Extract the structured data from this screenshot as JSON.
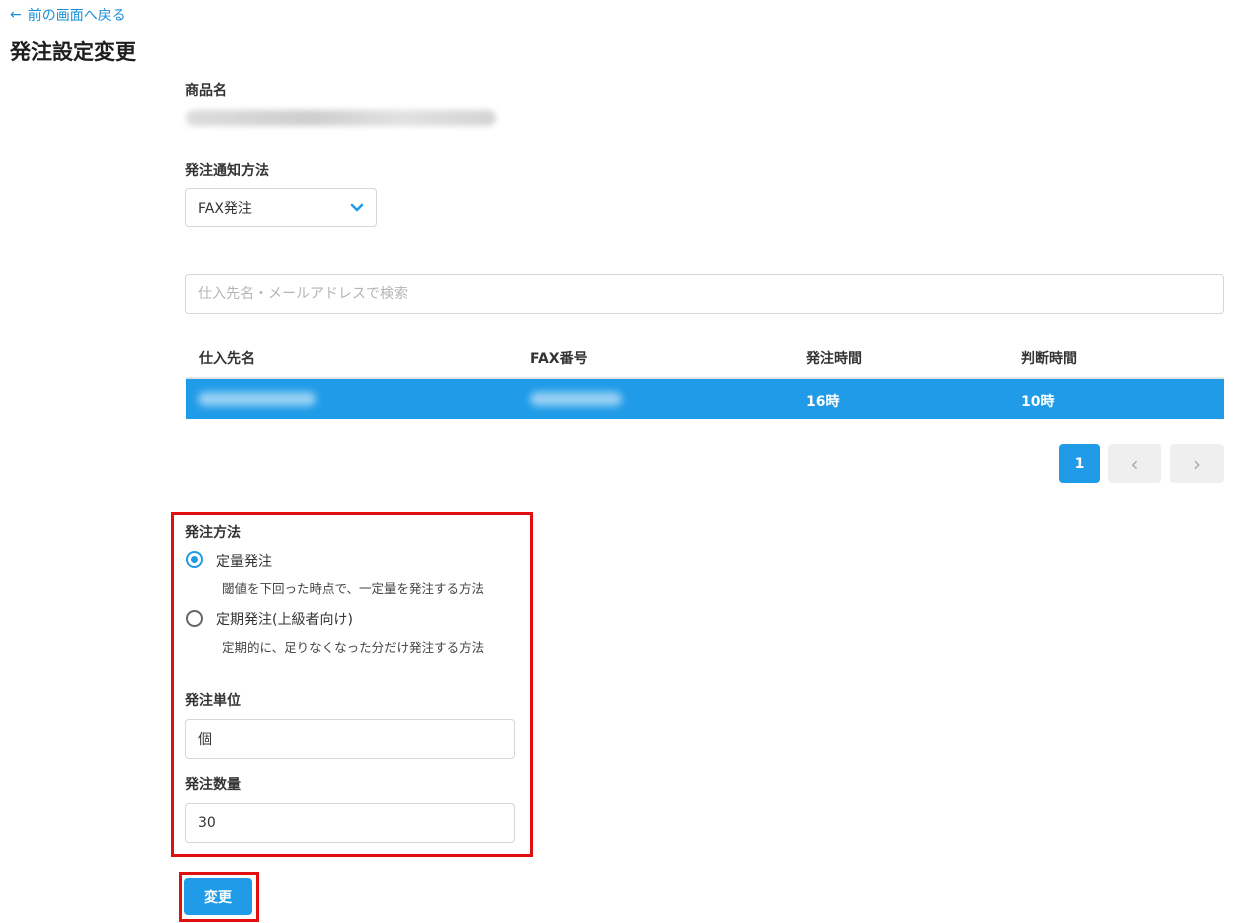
{
  "nav": {
    "back_arrow": "←",
    "back_label": "前の画面へ戻る"
  },
  "page": {
    "title": "発注設定変更"
  },
  "product": {
    "label": "商品名"
  },
  "notify": {
    "label": "発注通知方法",
    "selected": "FAX発注",
    "chevron_icon": "chevron-down-icon"
  },
  "search": {
    "placeholder": "仕入先名・メールアドレスで検索",
    "value": ""
  },
  "table": {
    "headers": [
      "仕入先名",
      "FAX番号",
      "発注時間",
      "判断時間"
    ],
    "rows": [
      {
        "order_time": "16時",
        "judge_time": "10時",
        "selected": true
      }
    ]
  },
  "pagination": {
    "current": "1",
    "prev": "‹",
    "next": "›"
  },
  "order_method": {
    "label": "発注方法",
    "options": [
      {
        "label": "定量発注",
        "description": "閾値を下回った時点で、一定量を発注する方法",
        "checked": true
      },
      {
        "label": "定期発注(上級者向け)",
        "description": "定期的に、足りなくなった分だけ発注する方法",
        "checked": false
      }
    ]
  },
  "order_unit": {
    "label": "発注単位",
    "value": "個"
  },
  "order_quantity": {
    "label": "発注数量",
    "value": "30"
  },
  "actions": {
    "submit_label": "変更"
  },
  "colors": {
    "accent": "#1f9be8",
    "highlight_border": "#e01010"
  }
}
